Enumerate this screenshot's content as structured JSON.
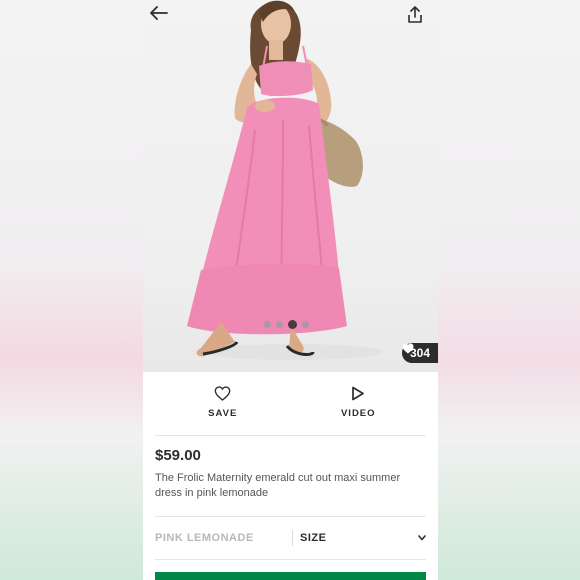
{
  "icons": {
    "back": "arrow-left-icon",
    "share": "share-icon",
    "heart": "heart-icon",
    "video": "play-icon",
    "chevron": "chevron-down-icon"
  },
  "gallery": {
    "dot_count": 4,
    "active_dot_index": 2,
    "likes_count": "304"
  },
  "actions": {
    "save_label": "SAVE",
    "video_label": "VIDEO"
  },
  "product": {
    "price": "$59.00",
    "title": "The Frolic Maternity emerald cut out maxi summer dress in pink lemonade"
  },
  "selectors": {
    "colour": "PINK LEMONADE",
    "size_label": "SIZE"
  },
  "colors": {
    "accent_green": "#018849",
    "text_dark": "#2d2d2d",
    "dress_pink": "#f08fb6"
  }
}
